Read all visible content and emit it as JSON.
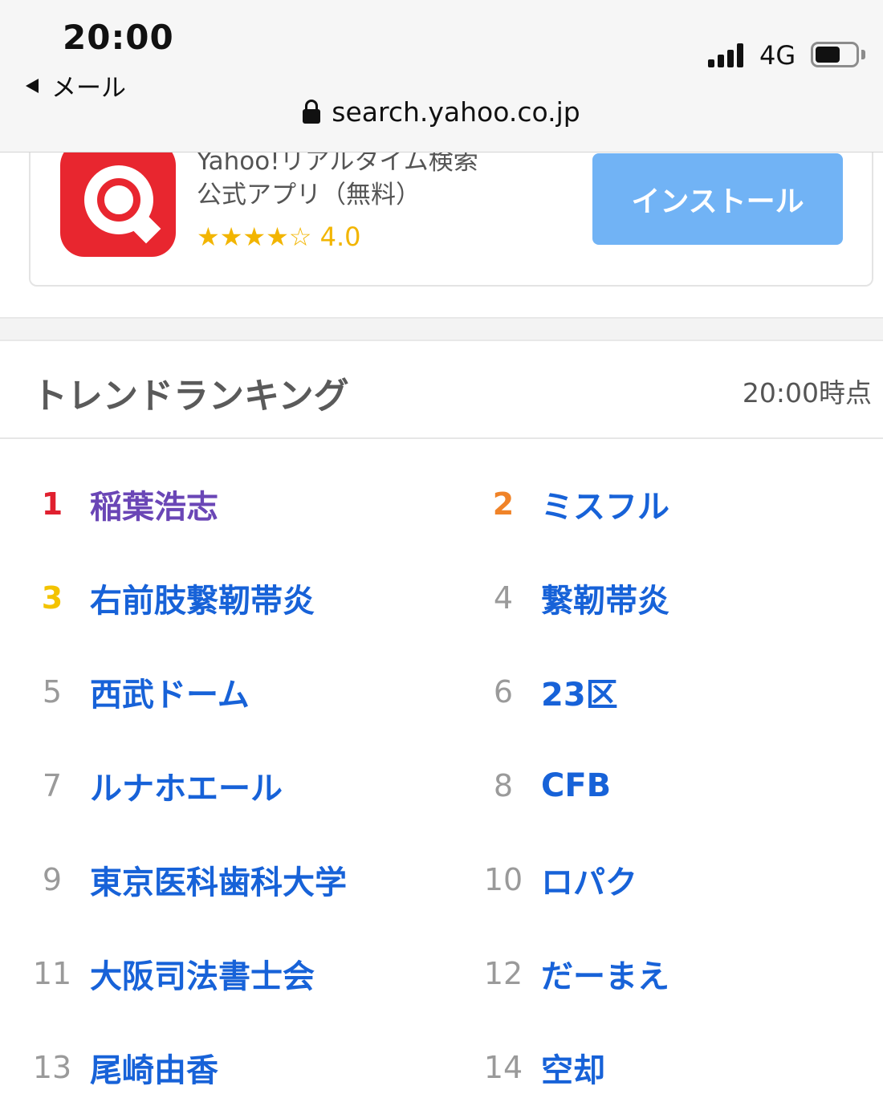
{
  "status_bar": {
    "time": "20:00",
    "back_label": "メール",
    "network": "4G"
  },
  "address_bar": {
    "url": "search.yahoo.co.jp"
  },
  "app_banner": {
    "title_line1": "Yahoo!リアルタイム検索",
    "title_line2": "公式アプリ（無料）",
    "stars": "★★★★☆",
    "rating": "4.0",
    "install_label": "インストール"
  },
  "ranking": {
    "title": "トレンドランキング",
    "updated": "20:00時点",
    "items": [
      {
        "rank": "1",
        "word": "稲葉浩志"
      },
      {
        "rank": "2",
        "word": "ミスフル"
      },
      {
        "rank": "3",
        "word": "右前肢繋靭帯炎"
      },
      {
        "rank": "4",
        "word": "繋靭帯炎"
      },
      {
        "rank": "5",
        "word": "西武ドーム"
      },
      {
        "rank": "6",
        "word": "23区"
      },
      {
        "rank": "7",
        "word": "ルナホエール"
      },
      {
        "rank": "8",
        "word": "CFB"
      },
      {
        "rank": "9",
        "word": "東京医科歯科大学"
      },
      {
        "rank": "10",
        "word": "ロパク"
      },
      {
        "rank": "11",
        "word": "大阪司法書士会"
      },
      {
        "rank": "12",
        "word": "だーまえ"
      },
      {
        "rank": "13",
        "word": "尾崎由香"
      },
      {
        "rank": "14",
        "word": "空却"
      }
    ]
  },
  "colors": {
    "link": "#1762d8",
    "visited_link": "#6a46b6",
    "rank1": "#e0202f",
    "rank2": "#f08328",
    "rank3": "#f3c300",
    "install_button": "#71b3f5",
    "app_icon": "#e8262f"
  }
}
